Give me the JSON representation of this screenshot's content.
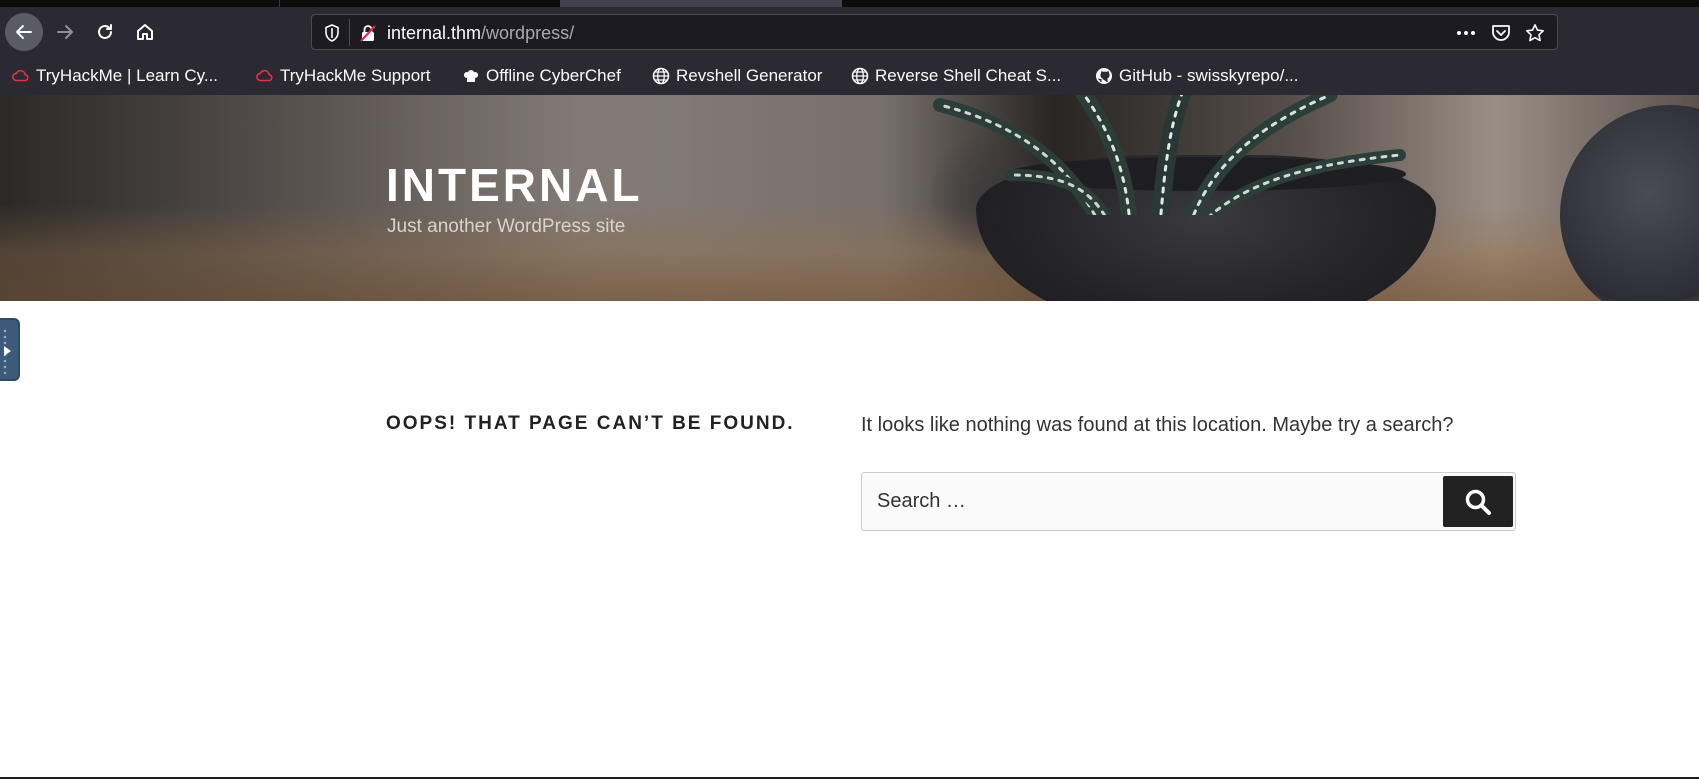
{
  "browser": {
    "url_host": "internal.thm",
    "url_path": "/wordpress/",
    "bookmarks": [
      {
        "label": "TryHackMe | Learn Cy...",
        "icon": "tryhackme-cloud-icon"
      },
      {
        "label": "TryHackMe Support",
        "icon": "tryhackme-cloud-icon"
      },
      {
        "label": "Offline CyberChef",
        "icon": "chef-hat-icon"
      },
      {
        "label": "Revshell Generator",
        "icon": "globe-icon"
      },
      {
        "label": "Reverse Shell Cheat S...",
        "icon": "globe-icon"
      },
      {
        "label": "GitHub - swisskyrepo/...",
        "icon": "github-icon"
      }
    ]
  },
  "site": {
    "title": "Internal",
    "description": "Just another WordPress site"
  },
  "content": {
    "error_title": "Oops! That page can’t be found.",
    "error_message": "It looks like nothing was found at this location. Maybe try a search?",
    "search_placeholder": "Search …"
  },
  "colors": {
    "chrome_bg": "#2b2a33",
    "urlbar_bg": "#1c1b22",
    "search_button": "#222222",
    "bookmark_red": "#e5323f"
  }
}
